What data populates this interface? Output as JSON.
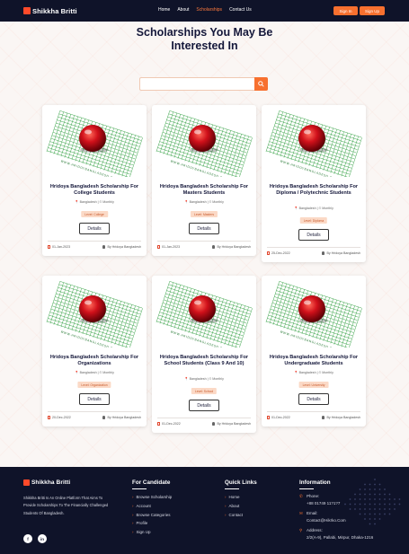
{
  "nav": {
    "logo": "Shikkha Britti",
    "links": [
      "Home",
      "About",
      "Scholarships",
      "Contact Us"
    ],
    "active_link": "Scholarships",
    "signin": "Sign In",
    "signup": "Sign Up"
  },
  "page": {
    "title_line1": "Scholarships You May Be",
    "title_line2": "Interested In"
  },
  "search": {
    "placeholder": "",
    "value": ""
  },
  "cards": [
    {
      "title": "Hridoya Bangladesh Scholarship For College Students",
      "meta": "📍 Bangladesh | ⏱ Monthly",
      "level": "Level: College",
      "details": "Details",
      "date": "01-Jan-2023",
      "author": "By Hridoya Bangladesh"
    },
    {
      "title": "Hridoya Bangladesh Scholarship For Masters Students",
      "meta": "📍 Bangladesh | ⏱ Monthly",
      "level": "Level: Masters",
      "details": "Details",
      "date": "01-Jan-2023",
      "author": "By Hridoya Bangladesh"
    },
    {
      "title": "Hridoya Bangladesh Scholarship For Diploma / Polytechnic Students",
      "meta": "📍 Bangladesh | ⏱ Monthly",
      "level": "Level: Diploma",
      "details": "Details",
      "date": "25-Dec-2022",
      "author": "By Hridoya Bangladesh"
    },
    {
      "title": "Hridoya Bangladesh Scholarship For Organizations",
      "meta": "📍 Bangladesh | ⏱ Monthly",
      "level": "Level: Organization",
      "details": "Details",
      "date": "20-Dec-2022",
      "author": "By Hridoya Bangladesh"
    },
    {
      "title": "Hridoya Bangladesh Scholarship For School Students (Class 9 And 10)",
      "meta": "📍 Bangladesh | ⏱ Monthly",
      "level": "Level: School",
      "details": "Details",
      "date": "01-Dec-2022",
      "author": "By Hridoya Bangladesh"
    },
    {
      "title": "Hridoya Bangladesh Scholarship For Undergraduate Students",
      "meta": "📍 Bangladesh | ⏱ Monthly",
      "level": "Level: University",
      "details": "Details",
      "date": "01-Dec-2022",
      "author": "By Hridoya Bangladesh"
    }
  ],
  "footer": {
    "logo": "Shikkha Britti",
    "about": "Shikkha Britti Is An Online Platform That Aims To Provide Scholarships To The Financially Challenged Students Of Bangladesh.",
    "social": [
      "f",
      "in"
    ],
    "candidate": {
      "heading": "For Candidate",
      "items": [
        "Browse Scholarship",
        "Account",
        "Browse Categories",
        "Profile",
        "Sign Up"
      ]
    },
    "quick": {
      "heading": "Quick Links",
      "items": [
        "Home",
        "About",
        "Contact"
      ]
    },
    "info": {
      "heading": "Information",
      "phone_label": "Phone:",
      "phone": "+88 01749 11?1?7",
      "email_label": "Email:",
      "email": "Contact@Hikrko.Com",
      "address_label": "Address:",
      "address": "2/2(A-9), Pallabi, Mirpur, Dhaka-1216"
    }
  },
  "colors": {
    "navy": "#0f1329",
    "accent": "#f7702f",
    "logo_red": "#ff4a2a",
    "level_bg": "#fbd9c6"
  }
}
